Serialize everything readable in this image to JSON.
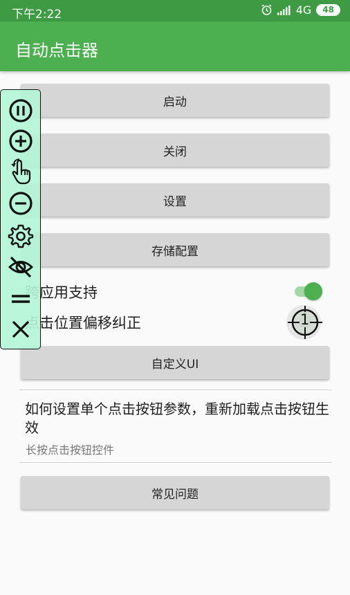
{
  "status_bar": {
    "time": "下午2:22",
    "network": "4G",
    "battery": "48"
  },
  "app_bar": {
    "title": "自动点击器"
  },
  "buttons": {
    "start": "启动",
    "close": "关闭",
    "settings": "设置",
    "save_config": "存储配置",
    "custom_ui": "自定义UI",
    "faq": "常见问题"
  },
  "options": {
    "cross_app_support": "跨应用支持",
    "cross_app_enabled": true,
    "offset_correction": "点击位置偏移纠正",
    "offset_marker_number": "1"
  },
  "help": {
    "title": "如何设置单个点击按钮参数，重新加载点击按钮生效",
    "subtitle": "长按点击按钮控件"
  },
  "floating_toolbar": {
    "icons": [
      "pause-icon",
      "add-icon",
      "tap-hand-icon",
      "remove-icon",
      "gear-icon",
      "hide-eye-icon",
      "drag-handle-icon",
      "close-icon"
    ]
  },
  "colors": {
    "primary": "#4caf50",
    "primary_dark": "#3e9b43",
    "float_panel": "#b2f6d6"
  }
}
